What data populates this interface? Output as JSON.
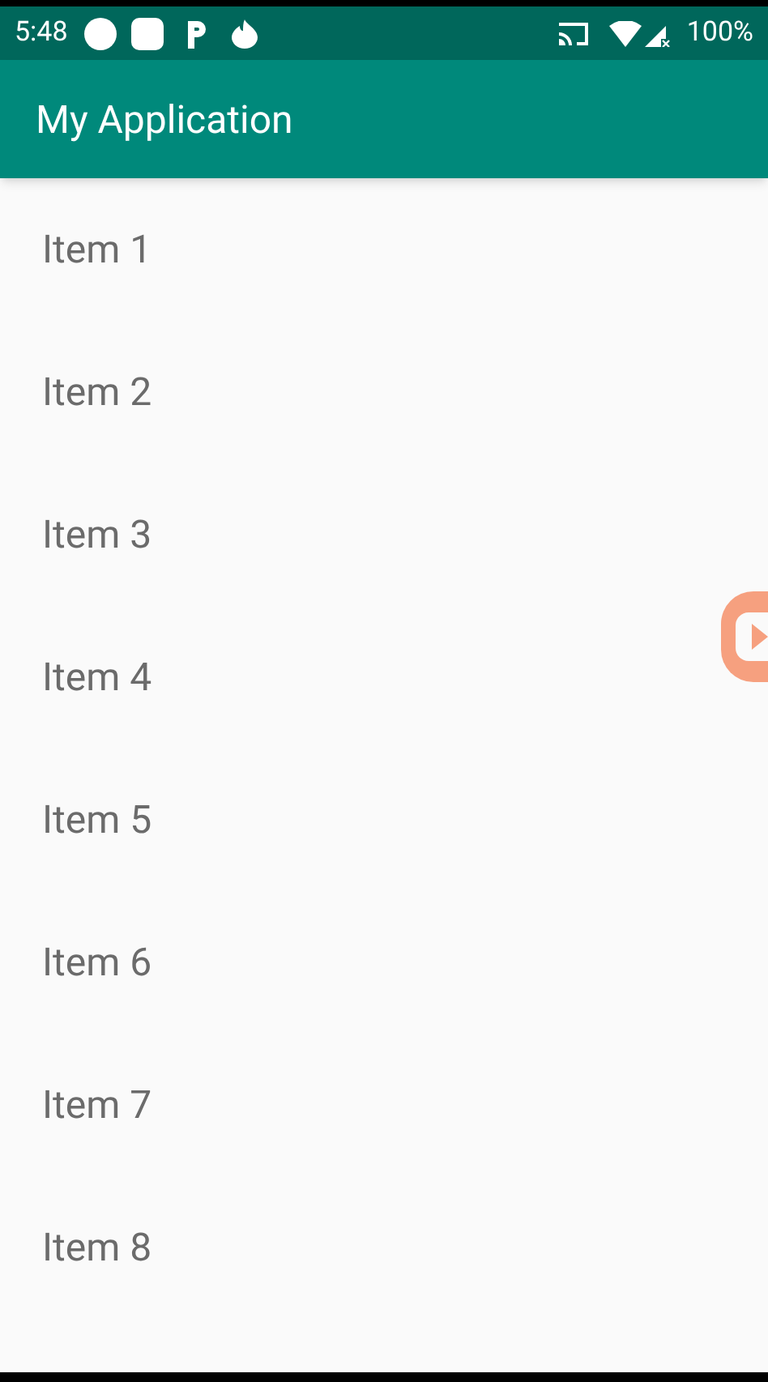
{
  "status_bar": {
    "time": "5:48",
    "battery": "100%"
  },
  "app_bar": {
    "title": "My Application"
  },
  "list": {
    "items": [
      {
        "label": "Item 1"
      },
      {
        "label": "Item 2"
      },
      {
        "label": "Item 3"
      },
      {
        "label": "Item 4"
      },
      {
        "label": "Item 5"
      },
      {
        "label": "Item 6"
      },
      {
        "label": "Item 7"
      },
      {
        "label": "Item 8"
      }
    ]
  }
}
